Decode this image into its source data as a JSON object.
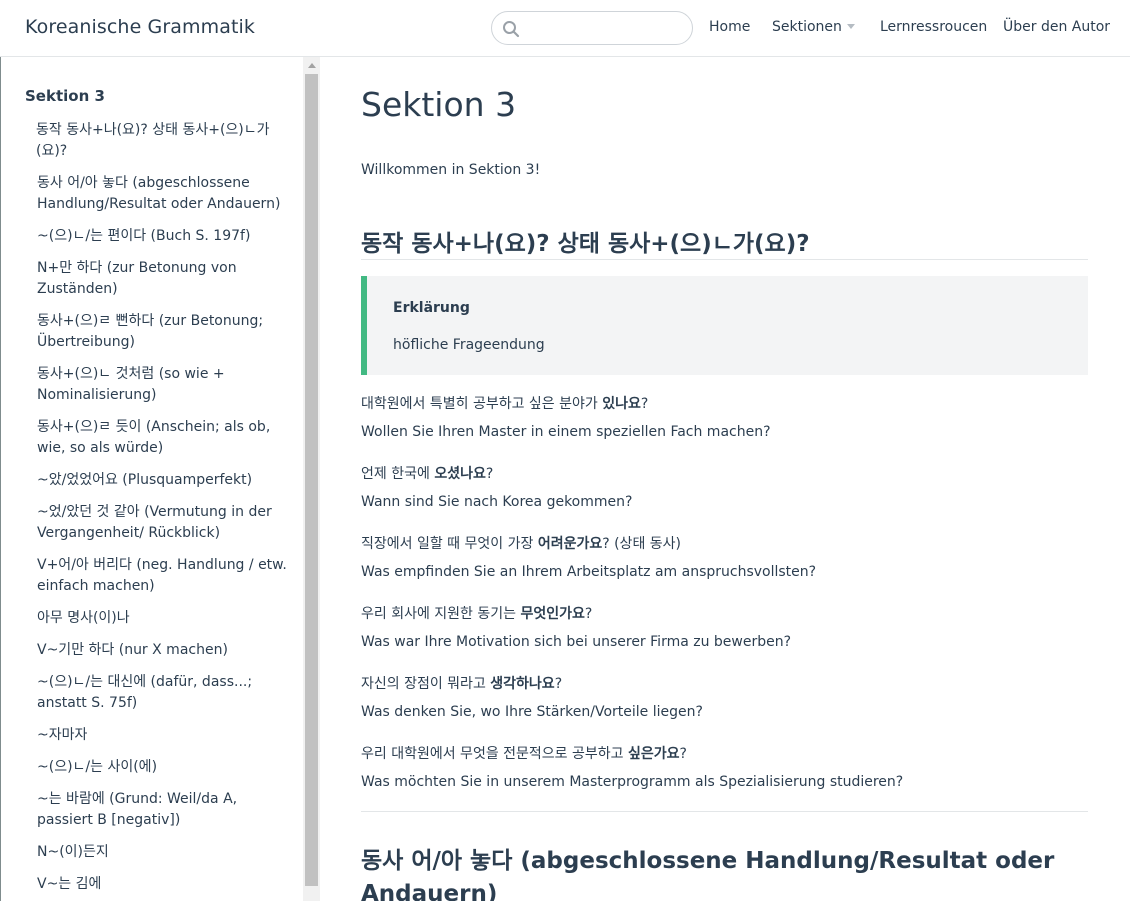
{
  "header": {
    "site_title": "Koreanische Grammatik",
    "search_placeholder": "",
    "nav": {
      "home": "Home",
      "sektionen": "Sektionen",
      "lernressourcen": "Lernressroucen",
      "autor": "Über den Autor"
    }
  },
  "sidebar": {
    "title": "Sektion 3",
    "items": [
      "동작 동사+나(요)? 상태 동사+(으)ㄴ가(요)?",
      "동사 어/아 놓다 (abgeschlossene Handlung/Resultat oder Andauern)",
      "~(으)ㄴ/는 편이다 (Buch S. 197f)",
      "N+만 하다 (zur Betonung von Zuständen)",
      "동사+(으)ㄹ 뻔하다 (zur Betonung; Übertreibung)",
      "동사+(으)ㄴ 것처럼 (so wie + Nominalisierung)",
      "동사+(으)ㄹ 듯이 (Anschein; als ob, wie, so als würde)",
      "~았/었었어요 (Plusquamperfekt)",
      "~었/았던 것 같아 (Vermutung in der Vergangenheit/ Rückblick)",
      "V+어/아 버리다 (neg. Handlung / etw. einfach machen)",
      "아무 명사(이)나",
      "V~기만 하다 (nur X machen)",
      "~(으)ㄴ/는 대신에 (dafür, dass...; anstatt S. 75f)",
      "~자마자",
      "~(으)ㄴ/는 사이(에)",
      "~는 바람에 (Grund: Weil/da A, passiert B [negativ])",
      "N~(이)든지",
      "V~는 김에"
    ]
  },
  "main": {
    "page_title": "Sektion 3",
    "welcome": "Willkommen in Sektion 3!",
    "section1": {
      "heading": "동작 동사+나(요)? 상태 동사+(으)ㄴ가(요)?",
      "callout_title": "Erklärung",
      "callout_body": "höfliche Frageendung",
      "examples": [
        {
          "kr_pre": "대학원에서 특별히 공부하고 싶은 분야가 ",
          "kr_bold": "있나요",
          "kr_post": "?",
          "de": "Wollen Sie Ihren Master in einem speziellen Fach machen?"
        },
        {
          "kr_pre": "언제 한국에 ",
          "kr_bold": "오셨나요",
          "kr_post": "?",
          "de": "Wann sind Sie nach Korea gekommen?"
        },
        {
          "kr_pre": "직장에서 일할 때 무엇이 가장 ",
          "kr_bold": "어려운가요",
          "kr_post": "? (상태 동사)",
          "de": "Was empfinden Sie an Ihrem Arbeitsplatz am anspruchsvollsten?"
        },
        {
          "kr_pre": "우리 회사에 지원한 동기는 ",
          "kr_bold": "무엇인가요",
          "kr_post": "?",
          "de": "Was war Ihre Motivation sich bei unserer Firma zu bewerben?"
        },
        {
          "kr_pre": "자신의 장점이 뭐라고 ",
          "kr_bold": "생각하나요",
          "kr_post": "?",
          "de": "Was denken Sie, wo Ihre Stärken/Vorteile liegen?"
        },
        {
          "kr_pre": "우리 대학원에서 무엇을 전문적으로 공부하고 ",
          "kr_bold": "싶은가요",
          "kr_post": "?",
          "de": "Was möchten Sie in unserem Masterprogramm als Spezialisierung studieren?"
        }
      ]
    },
    "section2": {
      "heading": "동사 어/아 놓다 (abgeschlossene Handlung/Resultat oder Andauern)"
    }
  }
}
